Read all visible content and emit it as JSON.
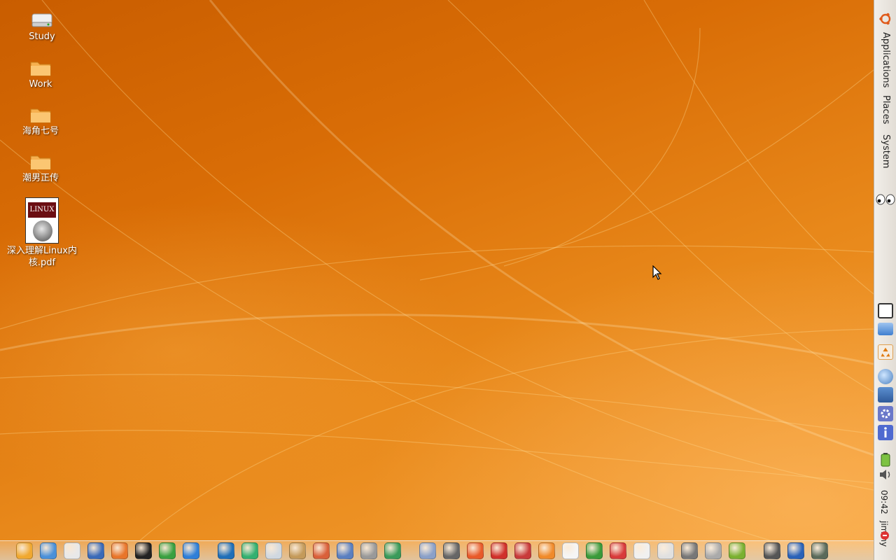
{
  "desktop": {
    "icons": [
      {
        "label": "Study",
        "kind": "drive"
      },
      {
        "label": "Work",
        "kind": "folder"
      },
      {
        "label": "海角七号",
        "kind": "folder"
      },
      {
        "label": "潮男正传",
        "kind": "folder"
      },
      {
        "label": "深入理解Linux内核.pdf",
        "kind": "pdf",
        "thumb_text": "LINUX"
      }
    ]
  },
  "panel": {
    "menus": [
      "Applications",
      "Places",
      "System"
    ],
    "clock": "09:42",
    "user": "jimmy",
    "colors": {
      "background": "#ece8e2",
      "accent": "#e07b10"
    }
  },
  "dock": {
    "items": [
      "home-folder-icon",
      "photo-manager-icon",
      "text-editor-icon",
      "compass-browser-icon",
      "firefox-icon",
      "qq-penguin-icon",
      "network-globe-icon",
      "pointer-tool-icon",
      "aptana-icon",
      "gem-icon",
      "network-tools-icon",
      "package-icon",
      "search-icon",
      "remote-desktop-icon",
      "tools-icon",
      "molecule-icon",
      "scanner-icon",
      "settings-gear-icon",
      "ball-game-icon",
      "chess-game-icon",
      "science-icon",
      "figure-game-icon",
      "cards-game-icon",
      "board-game-icon",
      "blocks-game-icon",
      "solitaire-icon",
      "hearts-icon",
      "screenshot-icon",
      "archive-icon",
      "nvidia-icon",
      "printer-icon",
      "bluetooth-icon",
      "calculator-icon"
    ]
  }
}
